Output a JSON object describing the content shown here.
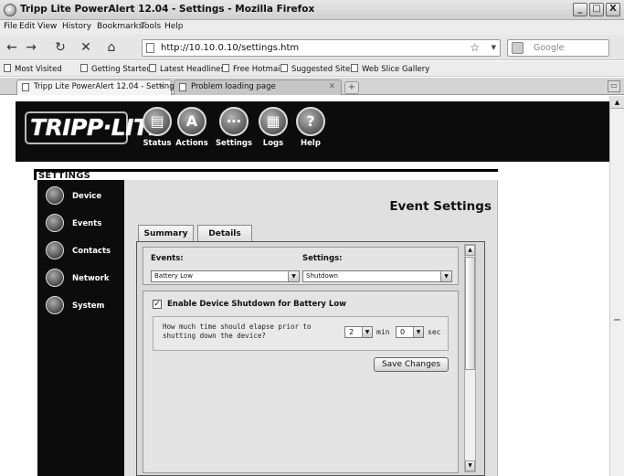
{
  "window": {
    "title": "Tripp Lite PowerAlert 12.04 - Settings - Mozilla Firefox",
    "minimize": "_",
    "maximize": "□",
    "close": "X"
  },
  "menu": [
    "File",
    "Edit",
    "View",
    "History",
    "Bookmarks",
    "Tools",
    "Help"
  ],
  "nav": {
    "url": "http://10.10.0.10/settings.htm",
    "search_placeholder": "Google"
  },
  "bookmarks": [
    "Most Visited",
    "Getting Started",
    "Latest Headlines",
    "Free Hotmail",
    "Suggested Sites",
    "Web Slice Gallery"
  ],
  "tabs": [
    {
      "label": "Tripp Lite PowerAlert 12.04 - Settings",
      "active": true
    },
    {
      "label": "Problem loading page",
      "active": false
    }
  ],
  "header": {
    "logo": "TRIPP·LITE",
    "nav": [
      {
        "label": "Status",
        "icon": "status-icon"
      },
      {
        "label": "Actions",
        "icon": "actions-icon"
      },
      {
        "label": "Settings",
        "icon": "settings-icon"
      },
      {
        "label": "Logs",
        "icon": "logs-icon"
      },
      {
        "label": "Help",
        "icon": "help-icon"
      }
    ]
  },
  "settings": {
    "section_title": "SETTINGS",
    "sidebar": [
      "Device",
      "Events",
      "Contacts",
      "Network",
      "System"
    ],
    "page_title": "Event Settings",
    "tabs": [
      "Summary",
      "Details"
    ],
    "events_label": "Events:",
    "events_value": "Battery Low",
    "settings_label": "Settings:",
    "settings_value": "Shutdown",
    "enable_label": "Enable Device Shutdown for Battery Low",
    "enable_checked": true,
    "delay_question": "How much time should elapse prior to shutting down the device?",
    "min_value": "2",
    "min_unit": "min",
    "sec_value": "0",
    "sec_unit": "sec",
    "save_label": "Save Changes"
  }
}
